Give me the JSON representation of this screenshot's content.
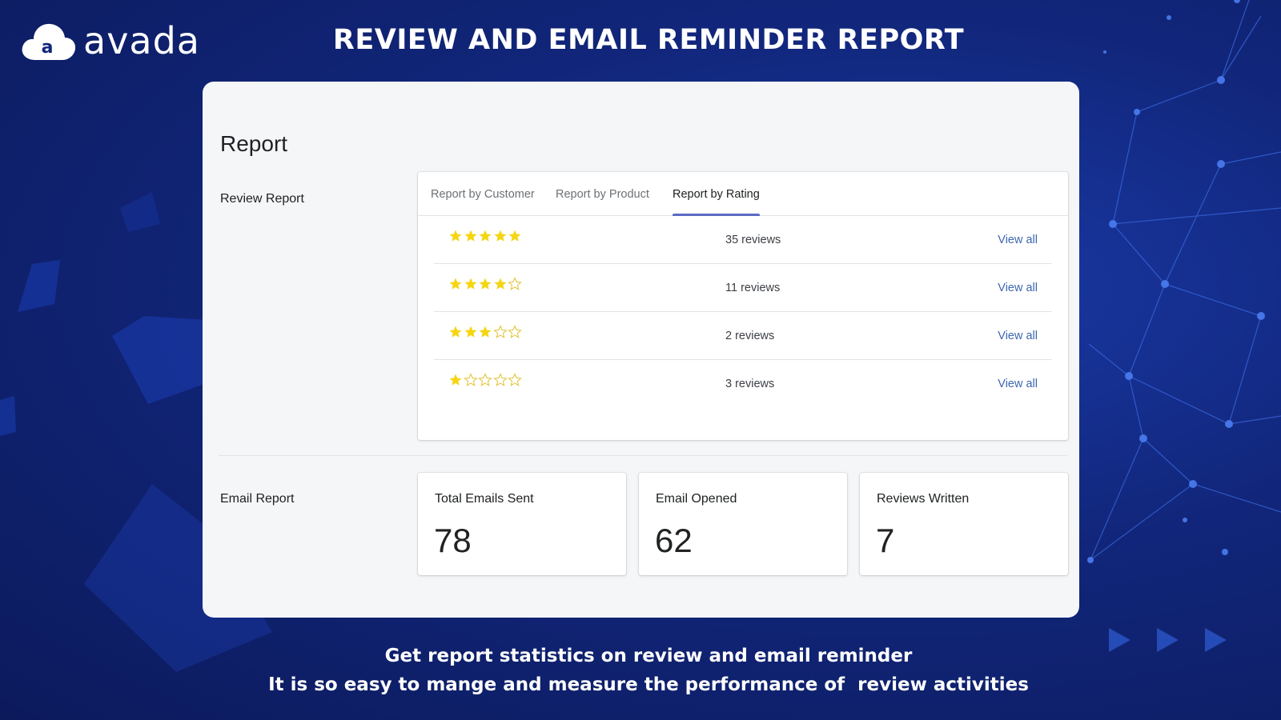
{
  "brand": {
    "name": "avada",
    "mark_letter": "a"
  },
  "headline": "REVIEW AND EMAIL REMINDER REPORT",
  "report": {
    "title": "Report",
    "review_section_label": "Review Report",
    "tabs": [
      {
        "label": "Report by Customer",
        "active": false
      },
      {
        "label": "Report by Product",
        "active": false
      },
      {
        "label": "Report by Rating",
        "active": true
      }
    ],
    "ratings": [
      {
        "stars": 5,
        "reviews": "35 reviews",
        "link": "View all"
      },
      {
        "stars": 4,
        "reviews": "11 reviews",
        "link": "View all"
      },
      {
        "stars": 3,
        "reviews": "2 reviews",
        "link": "View all"
      },
      {
        "stars": 1,
        "reviews": "3 reviews",
        "link": "View all"
      }
    ],
    "email_section_label": "Email Report",
    "stats": [
      {
        "label": "Total Emails Sent",
        "value": "78"
      },
      {
        "label": "Email Opened",
        "value": "62"
      },
      {
        "label": "Reviews Written",
        "value": "7"
      }
    ]
  },
  "caption": {
    "line1": "Get report statistics on review and email reminder",
    "line2": "It is so easy to mange and measure the performance of  review activities"
  },
  "colors": {
    "background": "#11267a",
    "panel": "#f5f6f8",
    "star_filled": "#f5d614",
    "star_empty": "#e3c53a",
    "tab_indicator": "#5c6ac4",
    "link": "#3c67b0"
  }
}
